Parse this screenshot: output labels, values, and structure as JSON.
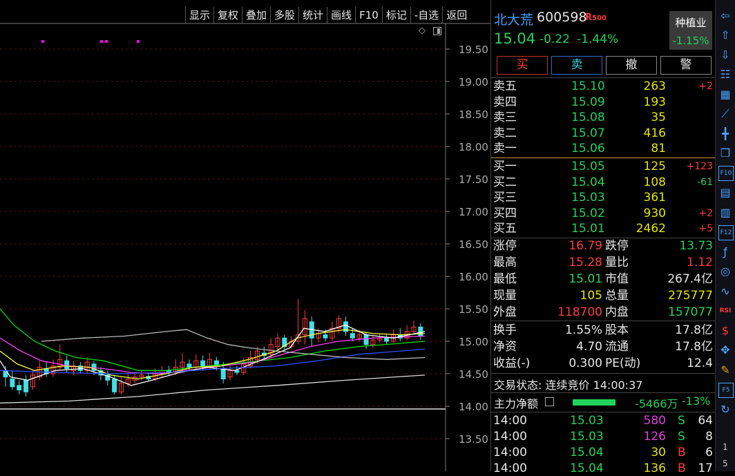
{
  "toolbar": [
    "显示",
    "复权",
    "叠加",
    "多股",
    "统计",
    "画线",
    "F10",
    "标记",
    "-自选",
    "返回"
  ],
  "price_axis": [
    "19.50",
    "19.00",
    "18.50",
    "18.00",
    "17.50",
    "17.00",
    "16.50",
    "16.00",
    "15.50",
    "15.00",
    "14.50",
    "14.00",
    "13.50"
  ],
  "stock": {
    "name": "北大荒",
    "code": "600598",
    "badge": "R",
    "badge_small": "500",
    "price": "15.04",
    "change": "-0.22",
    "pct": "-1.44%"
  },
  "sector": {
    "name": "种植业",
    "pct": "-1.15%"
  },
  "trade_buttons": [
    "买",
    "卖",
    "撤",
    "警"
  ],
  "asks": [
    {
      "label": "卖五",
      "price": "15.10",
      "vol": "263",
      "delta": "+2"
    },
    {
      "label": "卖四",
      "price": "15.09",
      "vol": "193",
      "delta": ""
    },
    {
      "label": "卖三",
      "price": "15.08",
      "vol": "35",
      "delta": ""
    },
    {
      "label": "卖二",
      "price": "15.07",
      "vol": "416",
      "delta": ""
    },
    {
      "label": "卖一",
      "price": "15.06",
      "vol": "81",
      "delta": ""
    }
  ],
  "bids": [
    {
      "label": "买一",
      "price": "15.05",
      "vol": "125",
      "delta": "+123"
    },
    {
      "label": "买二",
      "price": "15.04",
      "vol": "108",
      "delta": "-61"
    },
    {
      "label": "买三",
      "price": "15.03",
      "vol": "361",
      "delta": ""
    },
    {
      "label": "买四",
      "price": "15.02",
      "vol": "930",
      "delta": "+2"
    },
    {
      "label": "买五",
      "price": "15.01",
      "vol": "2462",
      "delta": "+5"
    }
  ],
  "stats1": [
    {
      "l1": "涨停",
      "v1": "16.79",
      "l2": "跌停",
      "v2": "13.73"
    },
    {
      "l1": "最高",
      "v1": "15.28",
      "l2": "量比",
      "v2": "1.12"
    },
    {
      "l1": "最低",
      "v1": "15.01",
      "l2": "市值",
      "v2": "267.4亿"
    },
    {
      "l1": "现量",
      "v1": "105",
      "l2": "总量",
      "v2": "275777"
    },
    {
      "l1": "外盘",
      "v1": "118700",
      "l2": "内盘",
      "v2": "157077"
    }
  ],
  "stats2": [
    {
      "l1": "换手",
      "v1": "1.55%",
      "l2": "股本",
      "v2": "17.8亿"
    },
    {
      "l1": "净资",
      "v1": "4.70",
      "l2": "流通",
      "v2": "17.8亿"
    },
    {
      "l1": "收益(-)",
      "v1": "0.300",
      "l2": "PE(动)",
      "v2": "12.4"
    }
  ],
  "trade_status": "交易状态: 连续竞价 14:00:37",
  "main_flow": {
    "label": "主力净额",
    "value": "-5466万",
    "pct": "-13%"
  },
  "ticks": [
    {
      "time": "14:00",
      "price": "15.03",
      "vol": "580",
      "side": "S",
      "num": "64"
    },
    {
      "time": "14:00",
      "price": "15.03",
      "vol": "126",
      "side": "S",
      "num": "8"
    },
    {
      "time": "14:00",
      "price": "15.04",
      "vol": "30",
      "side": "B",
      "num": "6"
    },
    {
      "time": "14:00",
      "price": "15.04",
      "vol": "136",
      "side": "B",
      "num": "17"
    }
  ],
  "side_icons": [
    "arrow-left-icon",
    "arrow-up-icon",
    "arrow-down-icon",
    "list-icon",
    "table-icon",
    "line-chart-icon",
    "candle-icon",
    "window-icon",
    "f10-icon",
    "doc-icon",
    "doc2-icon",
    "f12-icon",
    "fx-icon",
    "circle-icon",
    "wave-icon",
    "rsi-icon",
    "dollar-icon",
    "move-icon",
    "pencil-icon",
    "f5-icon",
    "refresh-icon"
  ],
  "side_labels": [
    "F10",
    "F12",
    "RSI",
    "F5",
    "1",
    "5"
  ],
  "colors": {
    "up": "#ff3b3b",
    "down": "#21d35c",
    "accent": "#4aa3ff"
  }
}
